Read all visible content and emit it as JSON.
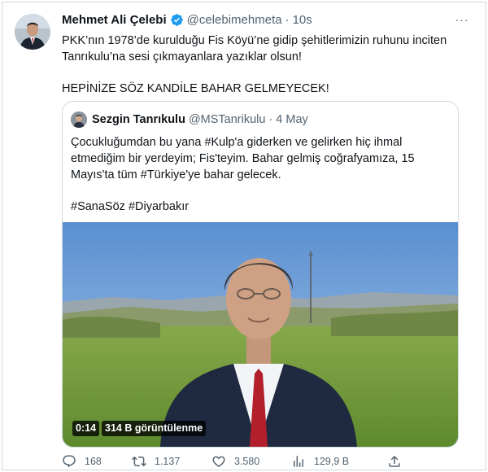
{
  "tweet": {
    "author_name": "Mehmet Ali Çelebi",
    "handle": "@celebimehmeta",
    "separator": "·",
    "time": "10s",
    "more_label": "···",
    "text_line1": "PKK’nın 1978’de kurulduğu Fis Köyü’ne gidip şehitlerimizin ruhunu inciten Tanrıkulu’na sesi çıkmayanlara yazıklar olsun!",
    "text_line2": "HEPİNİZE SÖZ KANDİLE BAHAR GELMEYECEK!"
  },
  "quoted_tweet": {
    "author_name": "Sezgin Tanrıkulu",
    "handle": "@MSTanrikulu",
    "separator": "·",
    "time": "4 May",
    "text_line1": "Çocukluğumdan bu yana #Kulp'a giderken ve gelirken hiç ihmal etmediğim bir yerdeyim; Fis'teyim. Bahar gelmiş coğrafyamıza, 15 Mayıs'ta tüm #Türkiye'ye bahar gelecek.",
    "text_line2": "#SanaSöz #Diyarbakır",
    "video": {
      "duration": "0:14",
      "views": "314 B görüntülenme"
    }
  },
  "actions": {
    "replies": "168",
    "retweets": "1.137",
    "likes": "3.580",
    "views": "129,9 B"
  },
  "colors": {
    "text_primary": "#0f1419",
    "text_secondary": "#536471",
    "verified_blue": "#1d9bf0",
    "border": "#cfd9de"
  },
  "icons": [
    "verified-badge-icon",
    "more-icon",
    "reply-icon",
    "retweet-icon",
    "like-icon",
    "views-icon",
    "share-icon"
  ]
}
